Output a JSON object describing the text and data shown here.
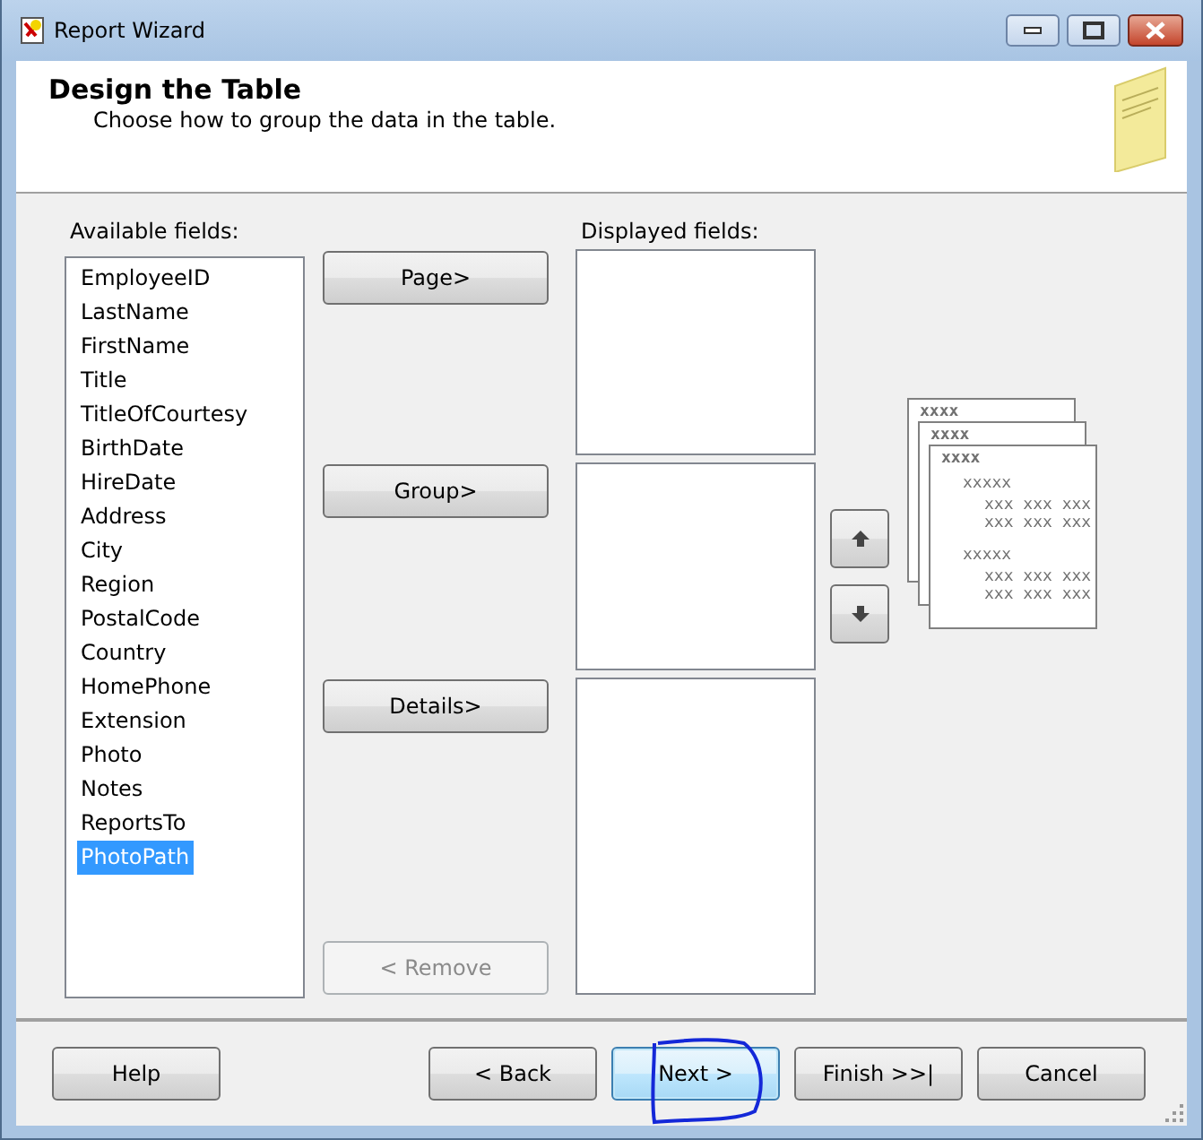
{
  "window": {
    "title": "Report Wizard"
  },
  "header": {
    "title": "Design the Table",
    "subtitle": "Choose how to group the data in the table."
  },
  "available": {
    "label": "Available fields:",
    "items": [
      {
        "label": "EmployeeID",
        "selected": false
      },
      {
        "label": "LastName",
        "selected": false
      },
      {
        "label": "FirstName",
        "selected": false
      },
      {
        "label": "Title",
        "selected": false
      },
      {
        "label": "TitleOfCourtesy",
        "selected": false
      },
      {
        "label": "BirthDate",
        "selected": false
      },
      {
        "label": "HireDate",
        "selected": false
      },
      {
        "label": "Address",
        "selected": false
      },
      {
        "label": "City",
        "selected": false
      },
      {
        "label": "Region",
        "selected": false
      },
      {
        "label": "PostalCode",
        "selected": false
      },
      {
        "label": "Country",
        "selected": false
      },
      {
        "label": "HomePhone",
        "selected": false
      },
      {
        "label": "Extension",
        "selected": false
      },
      {
        "label": "Photo",
        "selected": false
      },
      {
        "label": "Notes",
        "selected": false
      },
      {
        "label": "ReportsTo",
        "selected": false
      },
      {
        "label": "PhotoPath",
        "selected": true
      }
    ]
  },
  "actions": [
    {
      "kind": "add",
      "label": "Page>",
      "disabled": false
    },
    {
      "kind": "add",
      "label": "Group>",
      "disabled": false
    },
    {
      "kind": "add",
      "label": "Details>",
      "disabled": false
    },
    {
      "kind": "remove",
      "label": "< Remove",
      "disabled": true
    }
  ],
  "displayed": {
    "label": "Displayed fields:"
  },
  "preview": {
    "pages": [
      "xxxx",
      "xxxx",
      "xxxx"
    ],
    "groups": [
      {
        "label": "xxxxx",
        "rows": [
          "xxx xxx xxx",
          "xxx xxx xxx"
        ]
      },
      {
        "label": "xxxxx",
        "rows": [
          "xxx xxx xxx",
          "xxx xxx xxx"
        ]
      }
    ]
  },
  "footer": {
    "help": "Help",
    "buttons": [
      {
        "label": "< Back",
        "focused": false
      },
      {
        "label": "Next >",
        "focused": true
      },
      {
        "label": "Finish >>|",
        "focused": false
      },
      {
        "label": "Cancel",
        "focused": false
      }
    ]
  }
}
